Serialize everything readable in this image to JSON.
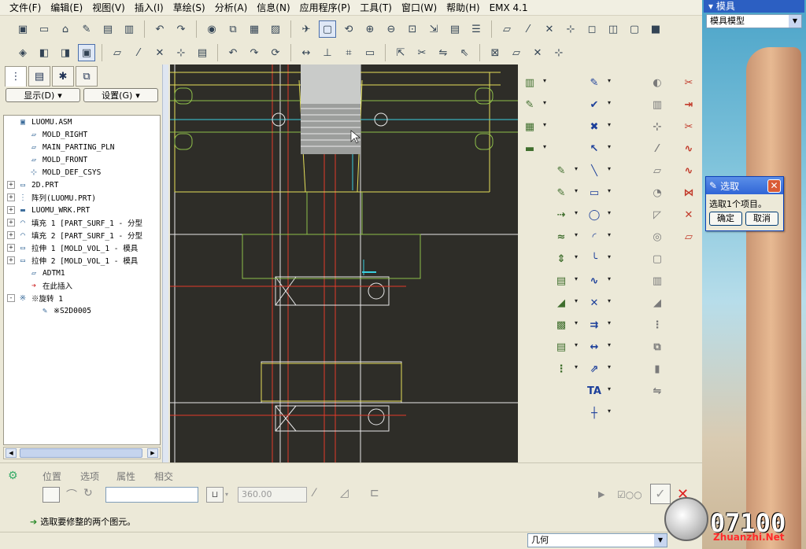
{
  "menubar": {
    "items": [
      "文件(F)",
      "编辑(E)",
      "视图(V)",
      "插入(I)",
      "草绘(S)",
      "分析(A)",
      "信息(N)",
      "应用程序(P)",
      "工具(T)",
      "窗口(W)",
      "帮助(H)",
      "EMX 4.1"
    ]
  },
  "toolbar1": {
    "icons": [
      "assembly-icon",
      "new-file-icon",
      "open-file-icon",
      "brush-icon",
      "save-icon",
      "save-copy-icon",
      "undo-icon",
      "redo-icon",
      "appearance-icon",
      "copy-icon",
      "paste-icon",
      "paste-special-icon",
      "navigator-icon",
      "repaint-icon",
      "spin-center-icon",
      "zoom-in-icon",
      "zoom-out-icon",
      "refit-icon",
      "reorient-icon",
      "saved-views-icon",
      "layers-icon",
      "datum-plane-display-icon",
      "datum-axis-display-icon",
      "point-display-icon",
      "csys-display-icon",
      "wireframe-icon",
      "hidden-line-icon",
      "no-hidden-icon",
      "shaded-icon"
    ]
  },
  "toolbar2": {
    "icons": [
      "view-cube-icon",
      "front-view-icon",
      "top-view-icon",
      "shaded-view-icon",
      "datum-plane-icon",
      "datum-axis-icon",
      "datum-point-icon",
      "csys-icon",
      "file-icon",
      "undo-icon",
      "redo-icon",
      "regenerate-icon",
      "dimension-icon",
      "constraint-icon",
      "grid-icon",
      "sketch-view-icon",
      "select-icon",
      "trim-icon",
      "mirror-icon",
      "pick-icon",
      "cancel-icon",
      "plane-icon",
      "point-icon",
      "csys-icon"
    ]
  },
  "model_tree": {
    "tabs": [
      "model-tree-icon",
      "folder-icon",
      "favorites-icon",
      "layer-tree-icon"
    ],
    "show_button": "显示(D)",
    "settings_button": "设置(G)",
    "nodes": [
      {
        "label": "LUOMU.ASM",
        "icon": "assembly-icon",
        "indent": 0,
        "expander": ""
      },
      {
        "label": "MOLD_RIGHT",
        "icon": "datum-plane-icon",
        "indent": 1,
        "expander": ""
      },
      {
        "label": "MAIN_PARTING_PLN",
        "icon": "datum-plane-icon",
        "indent": 1,
        "expander": ""
      },
      {
        "label": "MOLD_FRONT",
        "icon": "datum-plane-icon",
        "indent": 1,
        "expander": ""
      },
      {
        "label": "MOLD_DEF_CSYS",
        "icon": "csys-icon",
        "indent": 1,
        "expander": ""
      },
      {
        "label": "2D.PRT",
        "icon": "part-icon",
        "indent": 0,
        "expander": "+"
      },
      {
        "label": "阵列(LUOMU.PRT)",
        "icon": "pattern-icon",
        "indent": 0,
        "expander": "+"
      },
      {
        "label": "LUOMU_WRK.PRT",
        "icon": "workpiece-icon",
        "indent": 0,
        "expander": "+"
      },
      {
        "label": "填充 1 [PART_SURF_1 - 分型",
        "icon": "fill-surface-icon",
        "indent": 0,
        "expander": "+"
      },
      {
        "label": "填充 2 [PART_SURF_1 - 分型",
        "icon": "fill-surface-icon",
        "indent": 0,
        "expander": "+"
      },
      {
        "label": "拉伸 1 [MOLD_VOL_1 - 模具",
        "icon": "extrude-icon",
        "indent": 0,
        "expander": "+"
      },
      {
        "label": "拉伸 2 [MOLD_VOL_1 - 模具",
        "icon": "extrude-icon",
        "indent": 0,
        "expander": "+"
      },
      {
        "label": "ADTM1",
        "icon": "datum-plane-icon",
        "indent": 1,
        "expander": ""
      },
      {
        "label": "在此插入",
        "icon": "insert-here-icon",
        "indent": 1,
        "expander": ""
      },
      {
        "label": "※旋转 1",
        "icon": "revolve-icon",
        "indent": 0,
        "expander": "-"
      },
      {
        "label": "※S2D0005",
        "icon": "sketch-icon",
        "indent": 2,
        "expander": ""
      }
    ]
  },
  "feature_tools": {
    "col1": [
      "mold-base-icon",
      "eject-pin-icon",
      "cavity-layout-icon",
      "workpiece-icon",
      "parting-surface-icon",
      "volume-split-icon",
      "runner-icon",
      "water-line-icon",
      "mold-opening-icon",
      "database-icon",
      "draft-check-icon",
      "thickness-check-icon",
      "feature-table-icon",
      "mold-layout-icon"
    ],
    "col2": [
      "new-sketch-icon",
      "check-mark-icon",
      "cancel-x-icon",
      "select-arrow-icon",
      "line-icon",
      "rectangle-icon",
      "circle-icon",
      "arc-icon",
      "fillet-icon",
      "spline-icon",
      "point-icon",
      "offset-icon",
      "dimension-icon",
      "modify-icon",
      "text-icon",
      "centerline-icon"
    ],
    "col3": [
      "palette-icon",
      "view-orient-icon",
      "csys-icon",
      "axis-icon",
      "plane-icon",
      "round-icon",
      "chamfer-icon",
      "hole-icon",
      "shell-icon",
      "rib-icon",
      "draft-icon",
      "pattern-icon",
      "copy-geom-icon",
      "cylinder-icon",
      "mirror-icon"
    ],
    "col4": [
      "trim-icon",
      "extend-icon",
      "divide-icon",
      "curve-icon",
      "spline-icon",
      "merge-icon",
      "intersect-icon",
      "flatten-icon"
    ]
  },
  "dashboard": {
    "tabs": [
      "位置",
      "选项",
      "属性",
      "相交"
    ],
    "angle_value": "360.00",
    "text_field_value": ""
  },
  "status": {
    "message": "选取要修整的两个图元。"
  },
  "filter": {
    "value": "几何"
  },
  "side_window": {
    "header": "模具",
    "select_value": "模具模型"
  },
  "select_dialog": {
    "title": "选取",
    "message": "选取1个项目。",
    "ok": "确定",
    "cancel": "取消"
  },
  "watermark": {
    "number": "07100",
    "site": "Zhuanzhi.Net"
  },
  "colors": {
    "canvas_bg": "#2e2d28",
    "geometry_white": "#e8e8e8",
    "geometry_yellow": "#e5e05a",
    "geometry_green": "#8fc04a",
    "geometry_red": "#e23a2a",
    "geometry_cyan": "#3ad0e0",
    "title_blue": "#2c5fc2"
  }
}
